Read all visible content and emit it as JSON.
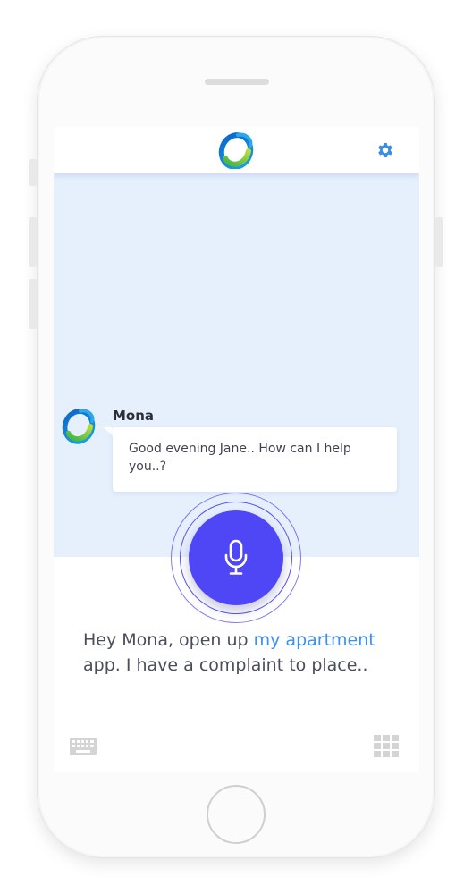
{
  "header": {
    "logo_icon": "assistant-logo-icon",
    "settings_icon": "gear-icon"
  },
  "chat": {
    "messages": [
      {
        "sender": "Mona",
        "avatar_icon": "assistant-logo-icon",
        "text": "Good evening Jane.. How can I help you..?"
      }
    ]
  },
  "voice": {
    "mic_icon": "microphone-icon",
    "transcript_before": "Hey Mona, open up ",
    "transcript_highlight": "my apartment",
    "transcript_after": " app. I have a complaint to place.."
  },
  "footer": {
    "left_icon": "keyboard-icon",
    "right_icon": "grid-icon"
  },
  "colors": {
    "accent": "#4f46f5",
    "chat_background": "#e6f0fd",
    "highlight_text": "#3c8ff0",
    "gear": "#3a8de5"
  }
}
